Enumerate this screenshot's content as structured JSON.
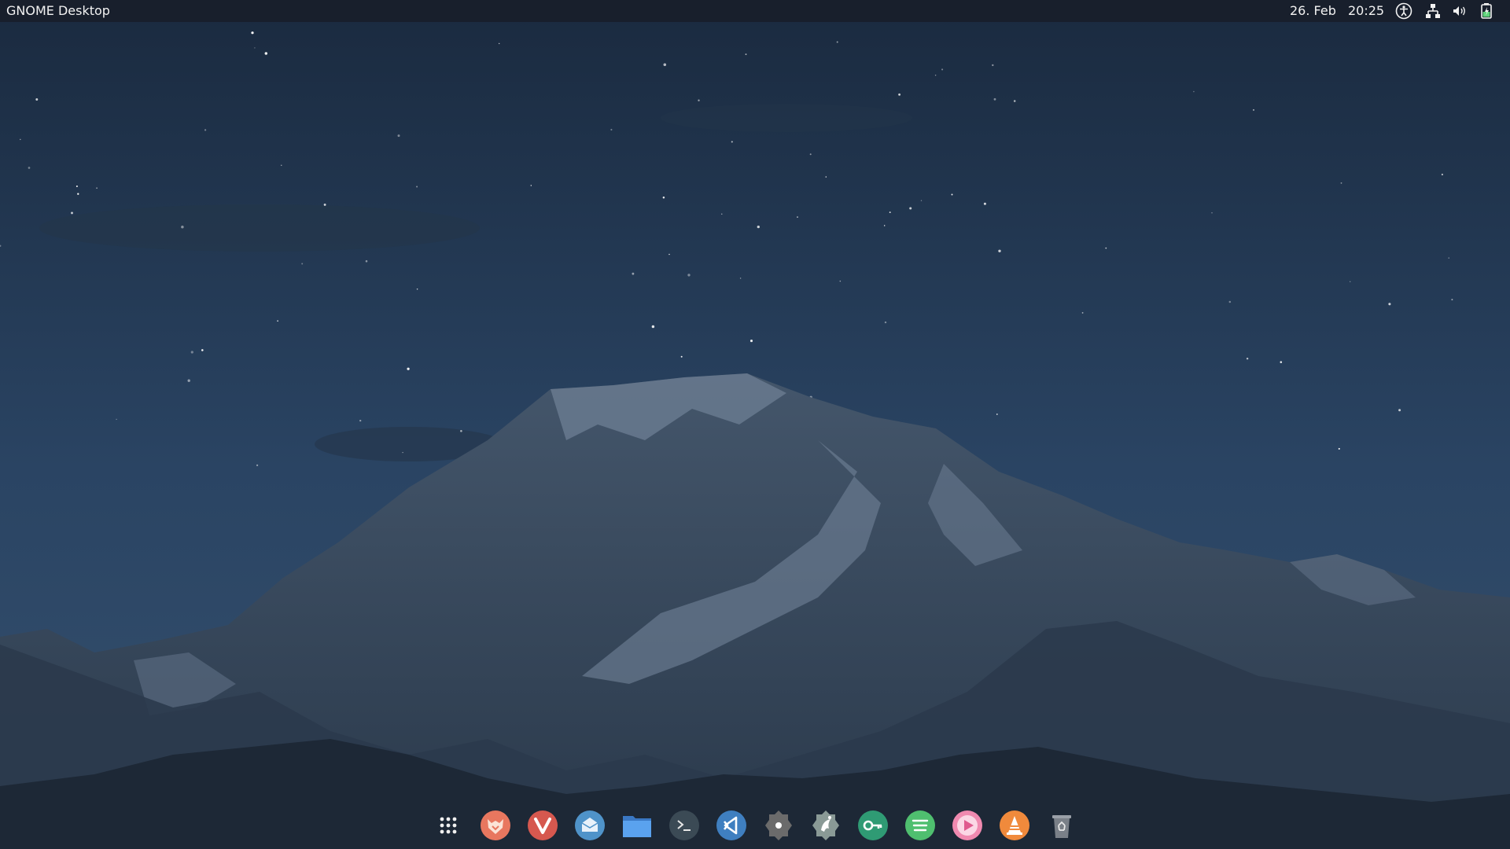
{
  "topbar": {
    "activities_label": "GNOME Desktop",
    "date": "26. Feb",
    "time": "20:25",
    "tray_icons": [
      "accessibility-icon",
      "network-icon",
      "volume-icon",
      "battery-charging-icon"
    ]
  },
  "dock": {
    "items": [
      {
        "name": "app-grid-icon",
        "color": "#ffffff"
      },
      {
        "name": "firefox-icon",
        "color": "#e8775f"
      },
      {
        "name": "vivaldi-icon",
        "color": "#d6584f"
      },
      {
        "name": "mail-icon",
        "color": "#4f93c9"
      },
      {
        "name": "files-folder-icon",
        "color": "#4c90de"
      },
      {
        "name": "terminal-icon",
        "color": "#3b4a55"
      },
      {
        "name": "vscode-icon",
        "color": "#3f7fc0"
      },
      {
        "name": "settings-icon",
        "color": "#6b6b6b"
      },
      {
        "name": "gimp-icon",
        "color": "#8a9a96"
      },
      {
        "name": "password-keys-icon",
        "color": "#2f9b74"
      },
      {
        "name": "spotify-icon",
        "color": "#4fbf6f"
      },
      {
        "name": "music-player-icon",
        "color": "#f08ab0"
      },
      {
        "name": "vlc-icon",
        "color": "#f08a3c"
      },
      {
        "name": "trash-icon",
        "color": "#7a8088"
      }
    ]
  },
  "colors": {
    "sky_top": "#1b2b40",
    "sky_bottom": "#2d4866",
    "mountain": "#3a4f66",
    "snow": "#6f8096",
    "topbar_bg": "#181e2a"
  }
}
